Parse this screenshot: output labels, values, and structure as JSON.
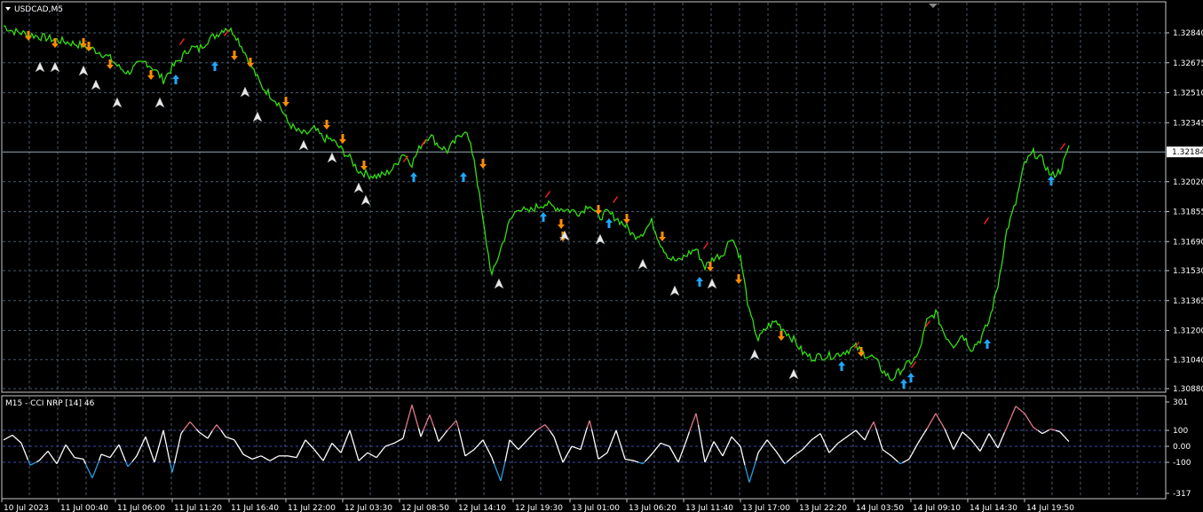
{
  "chart_data": [
    {
      "type": "line",
      "title": "USDCAD,M5",
      "ylim": [
        1.3088,
        1.3295
      ],
      "y_ticks": [
        1.3284,
        1.32675,
        1.3251,
        1.32345,
        1.3202,
        1.31855,
        1.3169,
        1.3153,
        1.31365,
        1.312,
        1.3104,
        1.3088
      ],
      "y_tick_labels": [
        "1.32840",
        "1.32675",
        "1.32510",
        "1.32345",
        "1.32020",
        "1.31855",
        "1.31690",
        "1.31530",
        "1.31365",
        "1.31200",
        "1.31040",
        "1.30880"
      ],
      "current_price": 1.32184,
      "current_price_label": "1.32184",
      "grid": true,
      "colors": {
        "line": "#33dd11",
        "up": "#1ea8ff",
        "down": "#ff8c00",
        "white_arrow": "#e8e8e8",
        "red_tick": "#ff2020",
        "grid": "#4a5a6a",
        "price_line": "#9aa8b4"
      },
      "x_labels": [
        "10 Jul 2023",
        "11 Jul 00:40",
        "11 Jul 06:00",
        "11 Jul 11:20",
        "11 Jul 16:40",
        "11 Jul 22:00",
        "12 Jul 03:30",
        "12 Jul 08:50",
        "12 Jul 14:10",
        "12 Jul 19:30",
        "13 Jul 01:00",
        "13 Jul 06:20",
        "13 Jul 11:40",
        "13 Jul 17:00",
        "13 Jul 22:20",
        "14 Jul 03:50",
        "14 Jul 09:10",
        "14 Jul 14:30",
        "14 Jul 19:50"
      ],
      "x": [
        0,
        10,
        20,
        30,
        40,
        50,
        60,
        70,
        80,
        90,
        100,
        110,
        120,
        130,
        140,
        150,
        160,
        170,
        180,
        190,
        200,
        210,
        220,
        230,
        240,
        250,
        260,
        270,
        280,
        290,
        300,
        310,
        320,
        330,
        340,
        350,
        360,
        370,
        380,
        390,
        400,
        410,
        420,
        430,
        440,
        450,
        460,
        470,
        480,
        490,
        500,
        510,
        520,
        530,
        540,
        550,
        560,
        570,
        580,
        590,
        600,
        610,
        620,
        630,
        640,
        650,
        660,
        670,
        680,
        690,
        700,
        710,
        720,
        730,
        740,
        750,
        760,
        770,
        780,
        790,
        800,
        810,
        820,
        830,
        840,
        850,
        860,
        870,
        880,
        890,
        900,
        910,
        920,
        930,
        940,
        950,
        960,
        970,
        980,
        990,
        1000,
        1010,
        1020,
        1030,
        1040,
        1050,
        1060,
        1070,
        1080,
        1090,
        1100,
        1110,
        1120,
        1130,
        1140,
        1150,
        1160,
        1170,
        1180,
        1190,
        1200
      ],
      "y": [
        1.3288,
        1.3285,
        1.3284,
        1.3283,
        1.3282,
        1.3281,
        1.328,
        1.3279,
        1.3278,
        1.3277,
        1.3275,
        1.3273,
        1.327,
        1.3265,
        1.3262,
        1.3266,
        1.3268,
        1.3264,
        1.3258,
        1.3265,
        1.327,
        1.3276,
        1.3275,
        1.328,
        1.3283,
        1.3287,
        1.3284,
        1.3275,
        1.3265,
        1.3255,
        1.325,
        1.3245,
        1.3235,
        1.323,
        1.3228,
        1.3231,
        1.3226,
        1.3225,
        1.322,
        1.3215,
        1.3208,
        1.3206,
        1.3205,
        1.3206,
        1.321,
        1.3218,
        1.3212,
        1.3222,
        1.3228,
        1.3222,
        1.3219,
        1.3225,
        1.3231,
        1.3215,
        1.318,
        1.315,
        1.3165,
        1.318,
        1.3188,
        1.3185,
        1.3188,
        1.319,
        1.3188,
        1.3187,
        1.3186,
        1.3185,
        1.319,
        1.3182,
        1.3185,
        1.3182,
        1.3178,
        1.3172,
        1.3174,
        1.318,
        1.3168,
        1.316,
        1.3158,
        1.3162,
        1.3165,
        1.3155,
        1.316,
        1.3162,
        1.3172,
        1.316,
        1.313,
        1.3115,
        1.3122,
        1.3125,
        1.312,
        1.3115,
        1.3108,
        1.3105,
        1.3106,
        1.3106,
        1.3107,
        1.3109,
        1.3111,
        1.3107,
        1.3105,
        1.3098,
        1.3093,
        1.3098,
        1.3102,
        1.3106,
        1.3125,
        1.313,
        1.3118,
        1.3112,
        1.3118,
        1.311,
        1.3115,
        1.3125,
        1.3145,
        1.3175,
        1.319,
        1.3212,
        1.3218,
        1.3214,
        1.3205,
        1.3208,
        1.322,
        1.3222
      ]
    },
    {
      "type": "line",
      "title": "M15 - CCI NRP [14] 46",
      "ylim": [
        -317,
        301
      ],
      "y_ticks": [
        301,
        100,
        0,
        -100,
        -317
      ],
      "y_tick_labels": [
        "301",
        "100",
        "0.00",
        "-100",
        "-317"
      ],
      "levels": [
        100,
        0,
        -100
      ],
      "colors": {
        "normal": "#ffffff",
        "over": "#e07a8a",
        "under": "#2a9fe0",
        "level": "#3a48a8"
      },
      "x": [
        0,
        10,
        20,
        30,
        40,
        50,
        60,
        70,
        80,
        90,
        100,
        110,
        120,
        130,
        140,
        150,
        160,
        170,
        180,
        190,
        200,
        210,
        220,
        230,
        240,
        250,
        260,
        270,
        280,
        290,
        300,
        310,
        320,
        330,
        340,
        350,
        360,
        370,
        380,
        390,
        400,
        410,
        420,
        430,
        440,
        450,
        460,
        470,
        480,
        490,
        500,
        510,
        520,
        530,
        540,
        550,
        560,
        570,
        580,
        590,
        600,
        610,
        620,
        630,
        640,
        650,
        660,
        670,
        680,
        690,
        700,
        710,
        720,
        730,
        740,
        750,
        760,
        770,
        780,
        790,
        800,
        810,
        820,
        830,
        840,
        850,
        860,
        870,
        880,
        890,
        900,
        910,
        920,
        930,
        940,
        950,
        960,
        970,
        980,
        990,
        1000,
        1010,
        1020,
        1030,
        1040,
        1050,
        1060,
        1070,
        1080,
        1090,
        1100,
        1110,
        1120,
        1130,
        1140,
        1150,
        1160,
        1170,
        1180,
        1190,
        1200
      ],
      "y": [
        40,
        70,
        20,
        -120,
        -90,
        -30,
        -110,
        10,
        -70,
        -80,
        -210,
        -50,
        -70,
        10,
        -130,
        -60,
        60,
        -100,
        100,
        -170,
        80,
        160,
        90,
        50,
        140,
        60,
        40,
        -50,
        -80,
        -60,
        -90,
        -60,
        -60,
        -70,
        40,
        -20,
        -90,
        20,
        -40,
        100,
        -90,
        -40,
        -70,
        0,
        20,
        50,
        280,
        60,
        210,
        30,
        100,
        170,
        -60,
        -20,
        40,
        -70,
        -230,
        40,
        -20,
        40,
        100,
        140,
        60,
        -100,
        0,
        -20,
        170,
        -80,
        -40,
        100,
        -80,
        -90,
        -110,
        -50,
        20,
        0,
        -100,
        50,
        220,
        -100,
        30,
        -60,
        60,
        0,
        -240,
        -40,
        40,
        -30,
        -110,
        -60,
        -20,
        40,
        80,
        -40,
        20,
        60,
        100,
        40,
        160,
        -20,
        -60,
        -110,
        -80,
        20,
        110,
        220,
        110,
        -20,
        90,
        40,
        -30,
        80,
        -10,
        120,
        270,
        220,
        120,
        80,
        110,
        90,
        30,
        200,
        30
      ]
    }
  ],
  "markers": {
    "up": [
      [
        198,
        90
      ],
      [
        242,
        75
      ],
      [
        466,
        200
      ],
      [
        522,
        200
      ],
      [
        612,
        245
      ],
      [
        686,
        252
      ],
      [
        788,
        318
      ],
      [
        948,
        413
      ],
      [
        1018,
        433
      ],
      [
        1026,
        426
      ],
      [
        1112,
        388
      ],
      [
        1184,
        204
      ]
    ],
    "down": [
      [
        32,
        40
      ],
      [
        62,
        48
      ],
      [
        94,
        48
      ],
      [
        100,
        52
      ],
      [
        124,
        72
      ],
      [
        170,
        84
      ],
      [
        264,
        62
      ],
      [
        282,
        70
      ],
      [
        322,
        114
      ],
      [
        368,
        140
      ],
      [
        386,
        156
      ],
      [
        410,
        186
      ],
      [
        544,
        184
      ],
      [
        632,
        252
      ],
      [
        634,
        266
      ],
      [
        674,
        236
      ],
      [
        706,
        246
      ],
      [
        746,
        266
      ],
      [
        800,
        300
      ],
      [
        832,
        314
      ],
      [
        880,
        378
      ],
      [
        970,
        396
      ]
    ],
    "white": [
      [
        45,
        76
      ],
      [
        62,
        76
      ],
      [
        94,
        80
      ],
      [
        108,
        96
      ],
      [
        132,
        116
      ],
      [
        180,
        116
      ],
      [
        276,
        104
      ],
      [
        290,
        132
      ],
      [
        342,
        164
      ],
      [
        374,
        178
      ],
      [
        404,
        212
      ],
      [
        412,
        226
      ],
      [
        562,
        320
      ],
      [
        636,
        266
      ],
      [
        676,
        270
      ],
      [
        724,
        298
      ],
      [
        760,
        328
      ],
      [
        802,
        320
      ],
      [
        850,
        400
      ],
      [
        894,
        422
      ]
    ],
    "red": [
      [
        204,
        46
      ],
      [
        254,
        36
      ],
      [
        456,
        178
      ],
      [
        476,
        160
      ],
      [
        616,
        218
      ],
      [
        692,
        224
      ],
      [
        794,
        276
      ],
      [
        964,
        388
      ],
      [
        1028,
        410
      ],
      [
        1044,
        364
      ],
      [
        1110,
        248
      ],
      [
        1196,
        164
      ]
    ]
  }
}
